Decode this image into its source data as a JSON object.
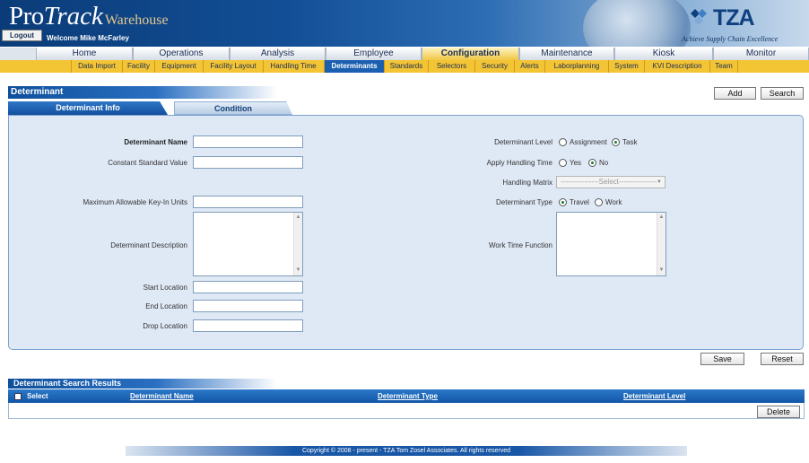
{
  "header": {
    "brand_pro": "Pro",
    "brand_track": "Track",
    "brand_sub": "Warehouse",
    "logout_label": "Logout",
    "welcome": "Welcome Mike McFarley",
    "logo_text": "TZA",
    "tagline": "Achieve Supply Chain Excellence"
  },
  "main_nav": {
    "items": [
      "Home",
      "Operations",
      "Analysis",
      "Employee",
      "Configuration",
      "Maintenance",
      "Kiosk",
      "Monitor"
    ],
    "active": "Configuration"
  },
  "sub_nav": {
    "items": [
      "Data Import",
      "Facility",
      "Equipment",
      "Facility Layout",
      "Handling Time",
      "Determinants",
      "Standards",
      "Selectors",
      "Security",
      "Alerts",
      "Laborplanning",
      "System",
      "KVI Description",
      "Team"
    ],
    "active": "Determinants"
  },
  "page": {
    "title": "Determinant",
    "add_label": "Add",
    "search_label": "Search"
  },
  "tabs": {
    "info": "Determinant Info",
    "condition": "Condition"
  },
  "form": {
    "name_label": "Determinant Name",
    "name_value": "",
    "constant_label": "Constant Standard Value",
    "constant_value": "",
    "maxkey_label": "Maximum Allowable Key-In Units",
    "maxkey_value": "",
    "desc_label": "Determinant Description",
    "desc_value": "",
    "start_label": "Start Location",
    "start_value": "",
    "end_label": "End Location",
    "end_value": "",
    "drop_label": "Drop Location",
    "drop_value": "",
    "level_label": "Determinant Level",
    "level_options": [
      "Assignment",
      "Task"
    ],
    "level_selected": "Task",
    "apply_label": "Apply Handling Time",
    "apply_options": [
      "Yes",
      "No"
    ],
    "apply_selected": "No",
    "matrix_label": "Handling Matrix",
    "matrix_selected": "----------------Select----------------",
    "type_label": "Determinant Type",
    "type_options": [
      "Travel",
      "Work"
    ],
    "type_selected": "Travel",
    "worktime_label": "Work Time Function",
    "worktime_value": "",
    "save_label": "Save",
    "reset_label": "Reset"
  },
  "results": {
    "title": "Determinant Search Results",
    "columns": [
      "Select",
      "Determinant Name",
      "Determinant Type",
      "Determinant Level"
    ],
    "delete_label": "Delete"
  },
  "footer": {
    "copyright": "Copyright © 2008 - present - TZA Tom Zosel Associates. All rights reserved"
  },
  "colors": {
    "nav_blue": "#1b5fb0",
    "sub_nav_gold": "#f3c434",
    "panel_bg": "#dfe9f6"
  }
}
